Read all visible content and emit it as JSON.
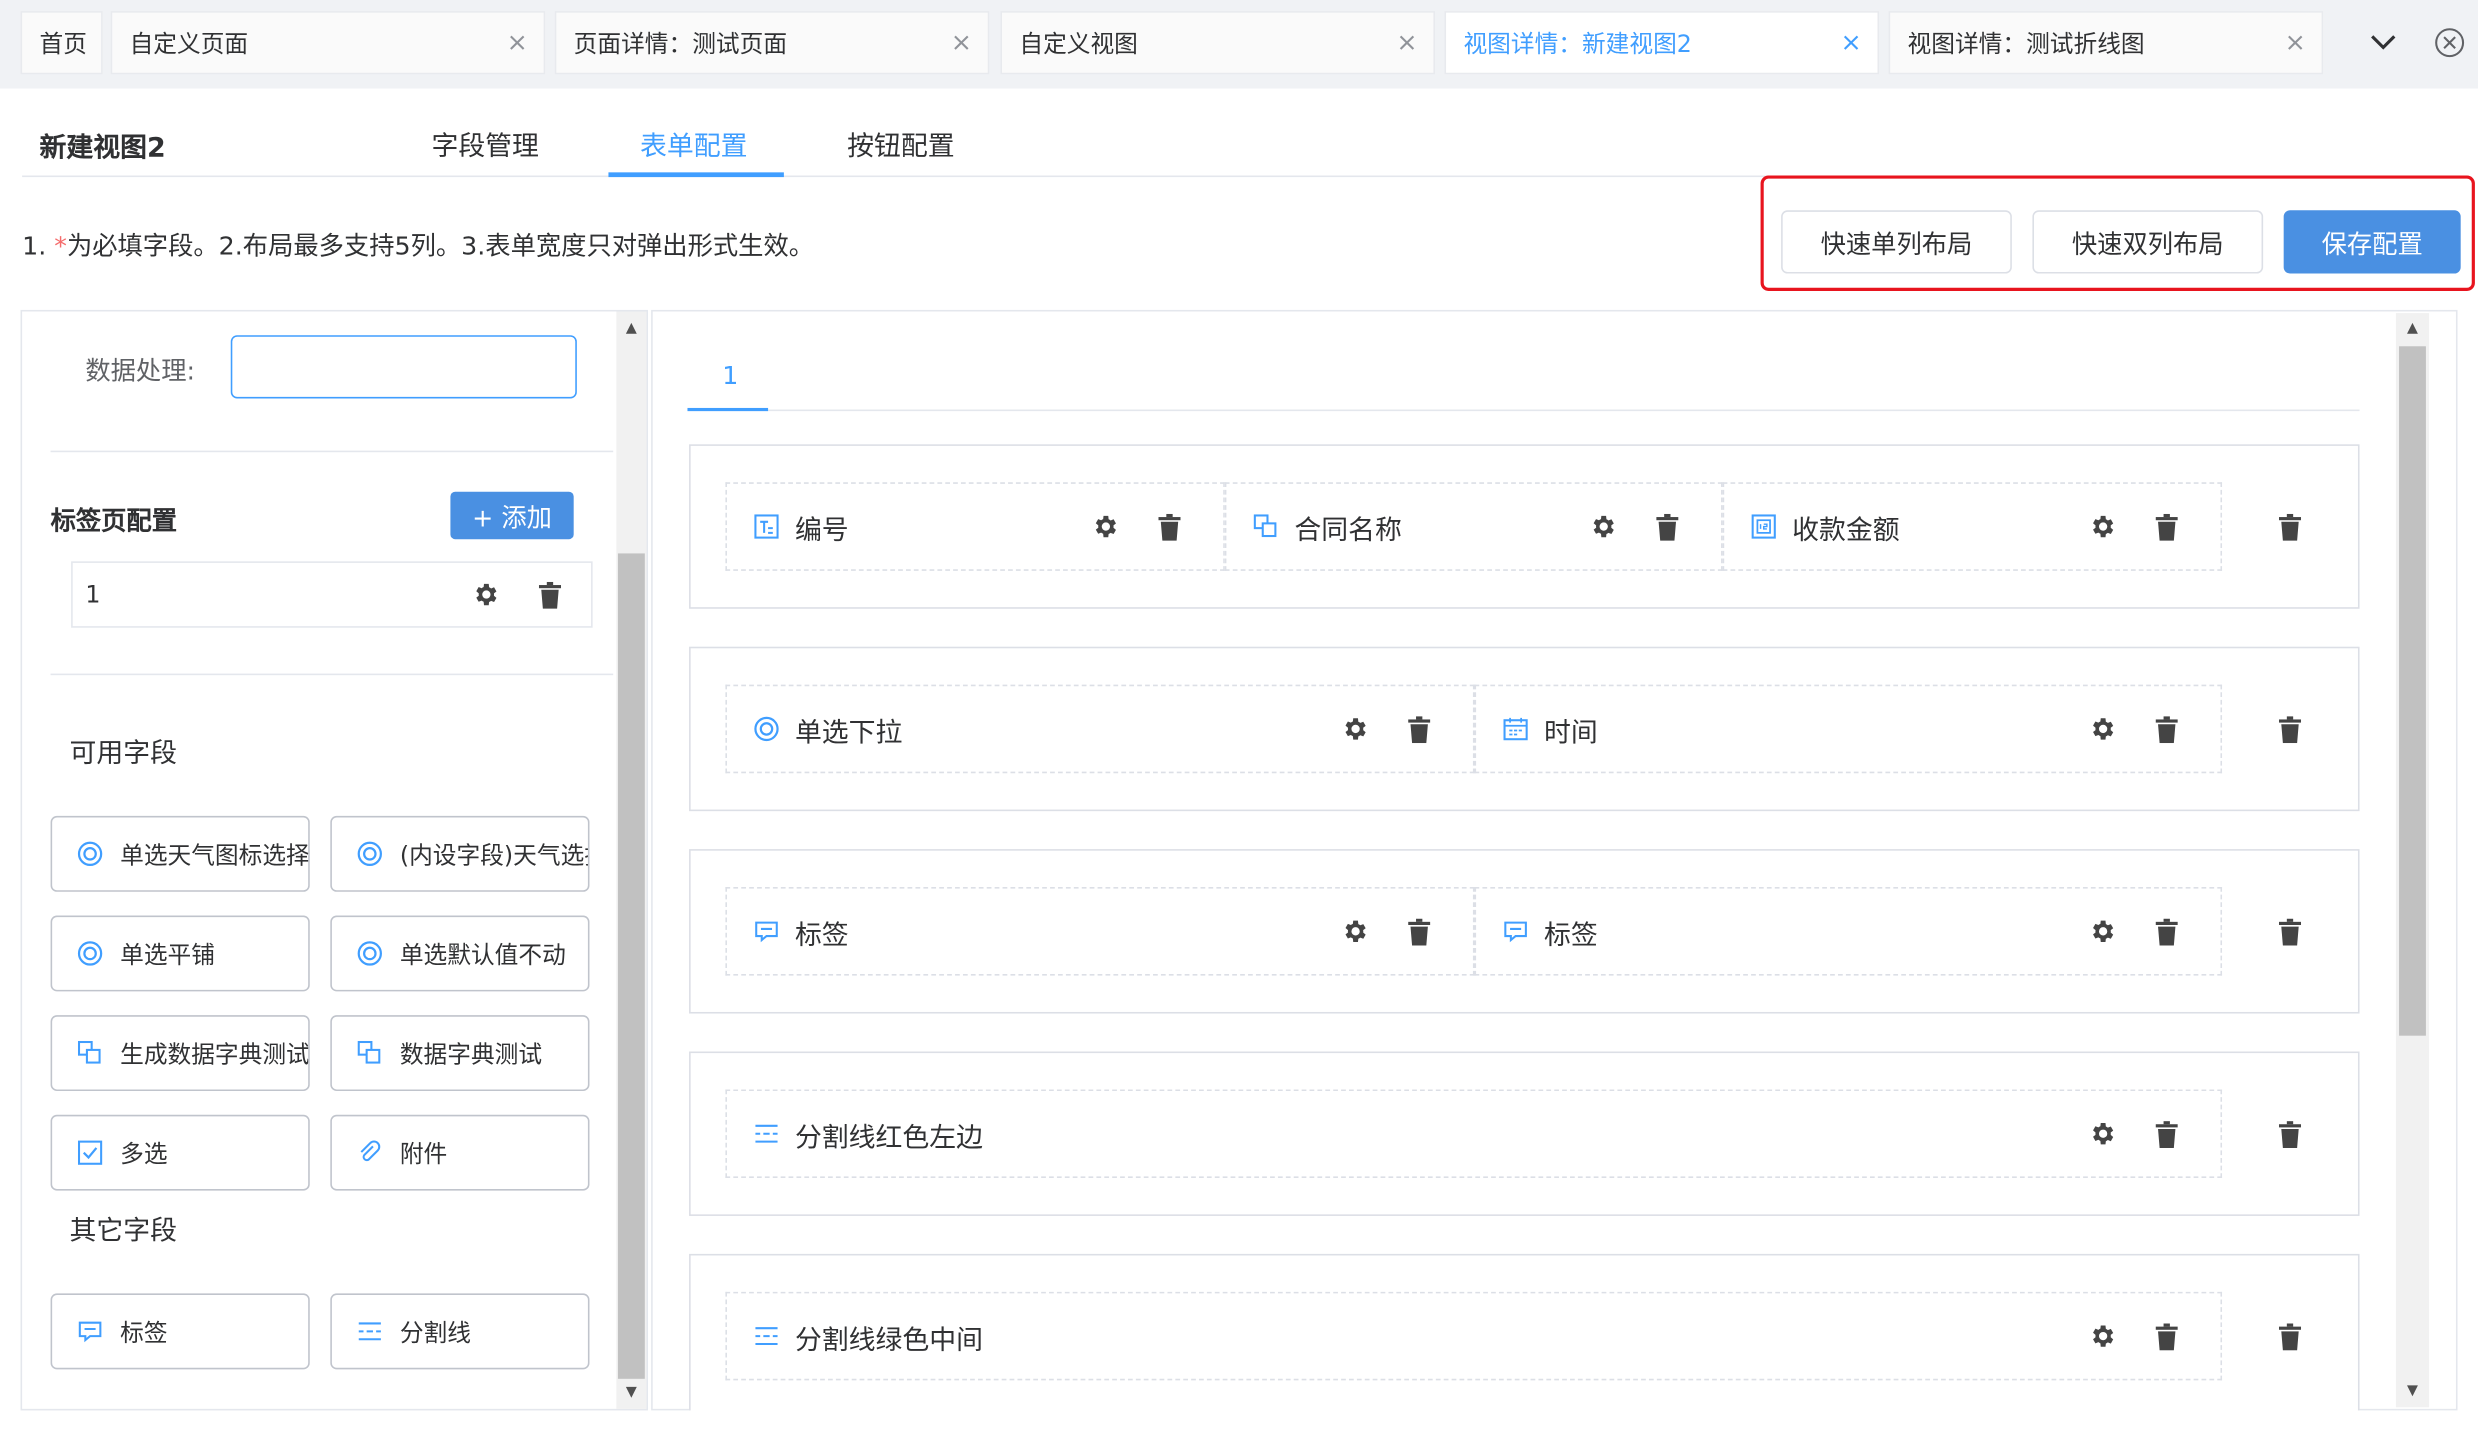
{
  "tabs": [
    {
      "label": "首页",
      "closable": false,
      "active": false
    },
    {
      "label": "自定义页面",
      "closable": true,
      "active": false
    },
    {
      "label": "页面详情：测试页面",
      "closable": true,
      "active": false
    },
    {
      "label": "自定义视图",
      "closable": true,
      "active": false
    },
    {
      "label": "视图详情：新建视图2",
      "closable": true,
      "active": true
    },
    {
      "label": "视图详情：测试折线图",
      "closable": true,
      "active": false
    }
  ],
  "tab_close_glyph": "×",
  "page": {
    "title": "新建视图2",
    "tabs": [
      "字段管理",
      "表单配置",
      "按钮配置"
    ],
    "active_tab": "表单配置"
  },
  "tip": {
    "prefix": "1. ",
    "required_mark": "*",
    "text": "为必填字段。2.布局最多支持5列。3.表单宽度只对弹出形式生效。"
  },
  "actions": {
    "single": "快速单列布局",
    "double": "快速双列布局",
    "save": "保存配置"
  },
  "left": {
    "data_process_label": "数据处理:",
    "data_process_value": "",
    "tab_config_title": "标签页配置",
    "add_label": "+ 添加",
    "tab_items": [
      "1"
    ],
    "available_title": "可用字段",
    "available_fields": [
      {
        "label": "单选天气图标选择",
        "icon": "radio-icon"
      },
      {
        "label": "(内设字段)天气选择",
        "icon": "radio-icon"
      },
      {
        "label": "单选平铺",
        "icon": "radio-icon"
      },
      {
        "label": "单选默认值不动",
        "icon": "radio-icon"
      },
      {
        "label": "生成数据字典测试",
        "icon": "dictionary-icon"
      },
      {
        "label": "数据字典测试",
        "icon": "dictionary-icon"
      },
      {
        "label": "多选",
        "icon": "checkbox-icon"
      },
      {
        "label": "附件",
        "icon": "paperclip-icon"
      }
    ],
    "other_title": "其它字段",
    "other_fields": [
      {
        "label": "标签",
        "icon": "label-icon"
      },
      {
        "label": "分割线",
        "icon": "divider-icon"
      }
    ]
  },
  "right": {
    "form_tab": "1",
    "rows": [
      {
        "cells": [
          {
            "label": "编号",
            "icon": "text-icon"
          },
          {
            "label": "合同名称",
            "icon": "dictionary-icon"
          },
          {
            "label": "收款金额",
            "icon": "number-icon"
          }
        ]
      },
      {
        "cells": [
          {
            "label": "单选下拉",
            "icon": "radio-icon"
          },
          {
            "label": "时间",
            "icon": "calendar-icon"
          }
        ]
      },
      {
        "cells": [
          {
            "label": "标签",
            "icon": "label-icon"
          },
          {
            "label": "标签",
            "icon": "label-icon"
          }
        ]
      },
      {
        "cells": [
          {
            "label": "分割线红色左边",
            "icon": "divider-icon"
          }
        ]
      },
      {
        "cells": [
          {
            "label": "分割线绿色中间",
            "icon": "divider-icon"
          }
        ]
      }
    ]
  },
  "colors": {
    "primary": "#409eff",
    "button_primary": "#4a90e2",
    "highlight": "#e8141e",
    "required": "#f56c6c"
  }
}
